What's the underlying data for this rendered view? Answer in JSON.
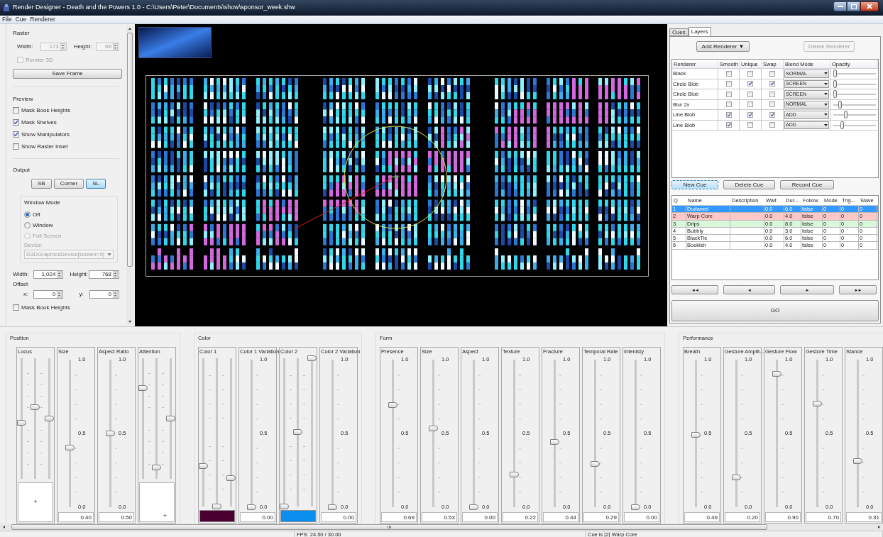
{
  "window": {
    "title": "Render Designer - Death and the Powers 1.0 - C:\\Users\\Peter\\Documents\\show\\sponsor_week.shw"
  },
  "menu": [
    "File",
    "Cue",
    "Renderer"
  ],
  "left_panel": {
    "raster": {
      "title": "Raster",
      "disabled": true,
      "width_label": "Width:",
      "width_value": "173",
      "height_label": "Height:",
      "height_value": "69",
      "render_3d": {
        "label": "Render 3D",
        "checked": false
      },
      "save_button": "Save Frame"
    },
    "preview": {
      "title": "Preview",
      "checkboxes": [
        {
          "label": "Mask Book Heights",
          "checked": false
        },
        {
          "label": "Mask Shelves",
          "checked": true
        },
        {
          "label": "Show Manipulators",
          "checked": true
        },
        {
          "label": "Show Raster Inset",
          "checked": false
        }
      ]
    },
    "output": {
      "title": "Output",
      "buttons": [
        {
          "label": "SB",
          "selected": false
        },
        {
          "label": "Corner",
          "selected": false
        },
        {
          "label": "SL",
          "selected": true
        }
      ],
      "window_mode": {
        "title": "Window Mode",
        "options": [
          {
            "label": "Off",
            "selected": true,
            "disabled": false
          },
          {
            "label": "Window",
            "selected": false,
            "disabled": false
          },
          {
            "label": "Full Screen",
            "selected": false,
            "disabled": true
          }
        ],
        "device_label": "Device:",
        "device_value": "D3DGraphicsDevice[screen=0]",
        "device_disabled": true
      },
      "width_label": "Width:",
      "width_value": "1,024",
      "height_label": "Height:",
      "height_value": "768",
      "offset_title": "Offset",
      "x_label": "x:",
      "x_value": "0",
      "y_label": "y:",
      "y_value": "0",
      "mask_checkbox": {
        "label": "Mask Book Heights",
        "checked": false
      }
    }
  },
  "right_panel": {
    "tabs": [
      {
        "label": "Cues",
        "selected": false
      },
      {
        "label": "Layers",
        "selected": true
      }
    ],
    "add_renderer": {
      "label": "Add Renderer",
      "caret": "▼"
    },
    "delete_renderer": {
      "label": "Delete Renderer",
      "disabled": true
    },
    "layers": {
      "columns": [
        "Renderer",
        "Smooth",
        "Unique",
        "Swap",
        "Blend Mode",
        "Opacity"
      ],
      "rows": [
        {
          "name": "Black",
          "smooth": false,
          "unique": false,
          "swap": false,
          "blend": "NORMAL",
          "level": 0.0
        },
        {
          "name": "Circle Blob",
          "smooth": false,
          "unique": true,
          "swap": true,
          "blend": "SCREEN",
          "level": 0.0
        },
        {
          "name": "Circle Blob",
          "smooth": false,
          "unique": false,
          "swap": false,
          "blend": "SCREEN",
          "level": 0.0
        },
        {
          "name": "Blur 2x",
          "smooth": false,
          "unique": false,
          "swap": false,
          "blend": "NORMAL",
          "level": 0.12
        },
        {
          "name": "Line Blob",
          "smooth": true,
          "unique": true,
          "swap": true,
          "blend": "ADD",
          "level": 0.27
        },
        {
          "name": "Line Blob",
          "smooth": true,
          "unique": false,
          "swap": false,
          "blend": "ADD",
          "level": 0.19
        }
      ]
    },
    "cue_buttons": [
      {
        "label": "New Cue",
        "focused": true
      },
      {
        "label": "Delete Cue",
        "focused": false
      },
      {
        "label": "Record Cue",
        "focused": false
      }
    ],
    "cues": {
      "columns": [
        "Q",
        "Name",
        "Description",
        "Wait",
        "Dur...",
        "Follow",
        "Mode",
        "Trig...",
        "Slave"
      ],
      "rows": [
        {
          "cells": [
            "1",
            "Dudamel",
            "",
            "0.0",
            "6.0",
            "false",
            "0",
            "0",
            "0"
          ],
          "selected": true
        },
        {
          "cells": [
            "2",
            "Warp Core",
            "",
            "0.0",
            "4.0",
            "false",
            "0",
            "0",
            "0"
          ],
          "selected": false,
          "color": "#ffc8c8"
        },
        {
          "cells": [
            "3",
            "Drips",
            "",
            "0.0",
            "8.0",
            "false",
            "0",
            "0",
            "0"
          ],
          "selected": false,
          "color": "#d9f7d9"
        },
        {
          "cells": [
            "4",
            "Bubbly",
            "",
            "0.0",
            "3.0",
            "false",
            "0",
            "0",
            "0"
          ],
          "selected": false
        },
        {
          "cells": [
            "5",
            "BlackTie",
            "",
            "0.0",
            "6.0",
            "false",
            "0",
            "0",
            "0"
          ],
          "selected": false
        },
        {
          "cells": [
            "6",
            "Bookish",
            "",
            "0.0",
            "4.0",
            "false",
            "0",
            "0",
            "0"
          ],
          "selected": false
        }
      ]
    },
    "transport": [
      "◄◄",
      "◄",
      "►",
      "►►"
    ],
    "go_button": "GO"
  },
  "control_groups": [
    {
      "title": "Position",
      "panels": [
        {
          "kind": "multi",
          "label": "Locus",
          "tracks": [
            {
              "level": 0.46
            },
            {
              "level": 0.59
            },
            {
              "level": 0.5
            }
          ],
          "lower": {
            "kind": "pad",
            "marker": "+",
            "marker_in_corner": false
          }
        },
        {
          "kind": "single",
          "label": "Size",
          "ticks": [
            "1.0",
            "0.5",
            "0.0"
          ],
          "level": 0.4,
          "value": "0.40"
        },
        {
          "kind": "single",
          "label": "Aspect Ratio",
          "ticks": [
            "1.0",
            "0.5",
            "0.0"
          ],
          "level": 0.5,
          "value": "0.50"
        },
        {
          "kind": "multi",
          "label": "Attention",
          "tracks": [
            {
              "level": 0.75
            },
            {
              "level": 0.09
            },
            {
              "level": 0.5
            }
          ],
          "lower": {
            "kind": "pad",
            "marker": "+",
            "marker_in_corner": true
          }
        }
      ]
    },
    {
      "title": "Color",
      "panels": [
        {
          "kind": "multi",
          "label": "Color 1",
          "tracks": [
            {
              "level": 0.27
            },
            {
              "level": 0.0
            },
            {
              "level": 0.19
            }
          ],
          "lower": {
            "kind": "swatch",
            "color": "#4a0030"
          }
        },
        {
          "kind": "single",
          "label": "Color 1 Variation",
          "ticks": [
            "1.0",
            "0.5",
            "0.0"
          ],
          "level": 0.0,
          "value": "0.00"
        },
        {
          "kind": "multi",
          "label": "Color 2",
          "tracks": [
            {
              "level": 0.0
            },
            {
              "level": 0.5
            },
            {
              "level": 1.0
            }
          ],
          "lower": {
            "kind": "swatch",
            "color": "#0a8ff0"
          }
        },
        {
          "kind": "single",
          "label": "Color 2 Variation",
          "ticks": [
            "1.0",
            "0.5",
            "0.0"
          ],
          "level": 0.0,
          "value": "0.00"
        }
      ]
    },
    {
      "title": "Form",
      "panels": [
        {
          "kind": "single",
          "label": "Presence",
          "ticks": [
            "1.0",
            "0.5",
            "0.0"
          ],
          "level": 0.69,
          "value": "0.69"
        },
        {
          "kind": "single",
          "label": "Size",
          "ticks": [
            "1.0",
            "0.5",
            "0.0"
          ],
          "level": 0.53,
          "value": "0.53"
        },
        {
          "kind": "single",
          "label": "Aspect",
          "ticks": [
            "1.0",
            "0.5",
            "0.0"
          ],
          "level": 0.0,
          "value": "0.00"
        },
        {
          "kind": "single",
          "label": "Texture",
          "ticks": [
            "1.0",
            "0.5",
            "0.0"
          ],
          "level": 0.22,
          "value": "0.22"
        },
        {
          "kind": "single",
          "label": "Fracture",
          "ticks": [
            "1.0",
            "0.5",
            "0.0"
          ],
          "level": 0.44,
          "value": "0.44"
        },
        {
          "kind": "single",
          "label": "Temporal Rate",
          "ticks": [
            "1.0",
            "0.5",
            "0.0"
          ],
          "level": 0.29,
          "value": "0.29"
        },
        {
          "kind": "single",
          "label": "Intenisty",
          "ticks": [
            "1.0",
            "0.5",
            "0.0"
          ],
          "level": 0.0,
          "value": "0.00"
        }
      ]
    },
    {
      "title": "Performance",
      "panels": [
        {
          "kind": "single",
          "label": "Breath",
          "ticks": [
            "1.0",
            "0.5",
            "0.0"
          ],
          "level": 0.49,
          "value": "0.49"
        },
        {
          "kind": "single",
          "label": "Gesture Amplit...",
          "ticks": [
            "1.0",
            "0.5",
            "0.0"
          ],
          "level": 0.2,
          "value": "0.20"
        },
        {
          "kind": "single",
          "label": "Gesture Flow",
          "ticks": [
            "1.0",
            "0.5",
            "0.0"
          ],
          "level": 0.9,
          "value": "0.90"
        },
        {
          "kind": "single",
          "label": "Gesture Time",
          "ticks": [
            "1.0",
            "0.5",
            "0.0"
          ],
          "level": 0.7,
          "value": "0.70"
        },
        {
          "kind": "single",
          "label": "Stance",
          "ticks": [
            "1.0",
            "0.5",
            "0.0"
          ],
          "level": 0.31,
          "value": "0.31"
        }
      ]
    }
  ],
  "status_bar": [
    "FPS: 24.50 / 30.00",
    "Cue is [2] Warp Core"
  ]
}
